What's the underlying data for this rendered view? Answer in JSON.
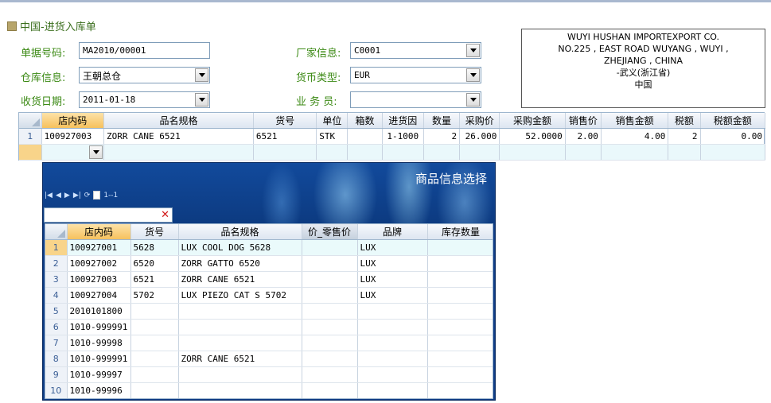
{
  "page": {
    "title": "中国-进货入库单"
  },
  "form": {
    "doc_no_label": "单据号码:",
    "doc_no_value": "MA2010/00001",
    "warehouse_label": "仓库信息:",
    "warehouse_value": "王朝总仓",
    "receive_date_label": "收货日期:",
    "receive_date_value": "2011-01-18",
    "supplier_label": "厂家信息:",
    "supplier_value": "C0001",
    "currency_label": "货币类型:",
    "currency_value": "EUR",
    "clerk_label": "业 务 员:",
    "clerk_value": ""
  },
  "address": {
    "lines": [
      "WUYI HUSHAN IMPORTEXPORT CO.",
      "NO.225 , EAST ROAD WUYANG , WUYI ,",
      "ZHEJIANG , CHINA",
      "-武义(浙江省)",
      "中国"
    ]
  },
  "main_grid": {
    "columns": [
      "店内码",
      "品名规格",
      "货号",
      "单位",
      "箱数",
      "进货因",
      "数量",
      "采购价",
      "采购金额",
      "销售价",
      "销售金额",
      "税额",
      "税额金额"
    ],
    "rows": [
      {
        "num": "1",
        "cells": [
          "100927003",
          "ZORR CANE 6521",
          "6521",
          "STK",
          "",
          "1-1000",
          "2",
          "26.000",
          "52.0000",
          "2.00",
          "4.00",
          "2",
          "0.00"
        ]
      }
    ]
  },
  "popup": {
    "title": "商品信息选择",
    "pager_text": "1--1",
    "search_value": "",
    "columns": [
      "店内码",
      "货号",
      "品名规格",
      "价_零售价",
      "品牌",
      "库存数量"
    ],
    "rows": [
      {
        "num": "1",
        "cells": [
          "100927001",
          "5628",
          "LUX COOL DOG 5628",
          "",
          "LUX",
          ""
        ]
      },
      {
        "num": "2",
        "cells": [
          "100927002",
          "6520",
          "ZORR GATTO 6520",
          "",
          "LUX",
          ""
        ]
      },
      {
        "num": "3",
        "cells": [
          "100927003",
          "6521",
          "ZORR CANE 6521",
          "",
          "LUX",
          ""
        ]
      },
      {
        "num": "4",
        "cells": [
          "100927004",
          "5702",
          "LUX PIEZO CAT S 5702",
          "",
          "LUX",
          ""
        ]
      },
      {
        "num": "5",
        "cells": [
          "2010101800",
          "",
          "",
          "",
          "",
          ""
        ]
      },
      {
        "num": "6",
        "cells": [
          "1010-999991",
          "",
          "",
          "",
          "",
          ""
        ]
      },
      {
        "num": "7",
        "cells": [
          "1010-99998",
          "",
          "",
          "",
          "",
          ""
        ]
      },
      {
        "num": "8",
        "cells": [
          "1010-999991",
          "",
          "ZORR CANE 6521",
          "",
          "",
          ""
        ]
      },
      {
        "num": "9",
        "cells": [
          "1010-99997",
          "",
          "",
          "",
          "",
          ""
        ]
      },
      {
        "num": "10",
        "cells": [
          "1010-99996",
          "",
          "",
          "",
          "",
          ""
        ]
      }
    ]
  }
}
